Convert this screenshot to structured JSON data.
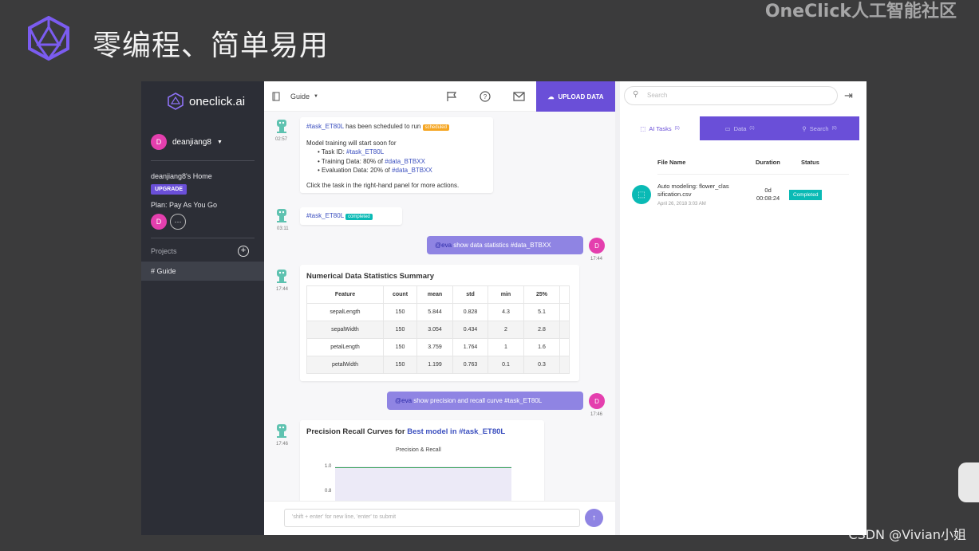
{
  "slide": {
    "title": "零编程、简单易用",
    "watermark_top": "OneClick人工智能社区",
    "watermark_bottom": "CSDN @Vivian小姐"
  },
  "sidebar": {
    "brand": "oneclick.ai",
    "username": "deanjiang8",
    "avatar_letter": "D",
    "home_label": "deanjiang8's Home",
    "upgrade": "UPGRADE",
    "plan": "Plan: Pay As You Go",
    "more": "···",
    "projects_label": "Projects",
    "add_label": "+",
    "project_item": "# Guide"
  },
  "toolbar": {
    "project_name": "Guide",
    "upload_label": "UPLOAD DATA"
  },
  "chat": {
    "msg1": {
      "time": "02:57",
      "tag": "#task_ET80L",
      "text": " has been scheduled to run ",
      "badge": "scheduled",
      "line1": "Model training will start soon for",
      "b1_label": "Task ID: ",
      "b1_tag": "#task_ET80L",
      "b2_label": "Training Data: 80% of ",
      "b2_tag": "#data_BTBXX",
      "b3_label": "Evaluation Data: 20% of ",
      "b3_tag": "#data_BTBXX",
      "footer": "Click the task in the right-hand panel for more actions."
    },
    "msg2": {
      "time": "03:11",
      "tag": "#task_ET80L",
      "badge": "completed"
    },
    "user1": {
      "time": "17:44",
      "mention": "@eva",
      "text": " show data statistics #data_BTBXX",
      "avatar": "D"
    },
    "msg3": {
      "time": "17:44",
      "title": "Numerical Data Statistics Summary",
      "headers": [
        "Feature",
        "count",
        "mean",
        "std",
        "min",
        "25%"
      ],
      "rows": [
        [
          "sepalLength",
          "150",
          "5.844",
          "0.828",
          "4.3",
          "5.1"
        ],
        [
          "sepalWidth",
          "150",
          "3.054",
          "0.434",
          "2",
          "2.8"
        ],
        [
          "petalLength",
          "150",
          "3.759",
          "1.764",
          "1",
          "1.6"
        ],
        [
          "petalWidth",
          "150",
          "1.199",
          "0.763",
          "0.1",
          "0.3"
        ]
      ]
    },
    "user2": {
      "time": "17:46",
      "mention": "@eva",
      "text": " show precision and recall curve #task_ET80L",
      "avatar": "D"
    },
    "msg4": {
      "time": "17:46",
      "title_a": "Precision Recall Curves for ",
      "title_b": "Best model in",
      "title_c": " #task_ET80L",
      "chart_title": "Precision & Recall",
      "y1": "1.0",
      "y2": "0.8"
    }
  },
  "input": {
    "placeholder": "'shift + enter' for new line, 'enter' to submit"
  },
  "right_panel": {
    "search_placeholder": "Search",
    "tabs": [
      {
        "label": "AI Tasks",
        "count": "(1)"
      },
      {
        "label": "Data",
        "count": "(1)"
      },
      {
        "label": "Search",
        "count": "(0)"
      }
    ],
    "columns": [
      "File Name",
      "Duration",
      "Status"
    ],
    "task": {
      "name_line1": "Auto modeling: flower_clas",
      "name_line2": "sification.csv",
      "date": "April 26, 2018 3:03 AM",
      "duration_line1": "0d",
      "duration_line2": "00:08:24",
      "status": "Completed"
    }
  },
  "colors": {
    "accent": "#6a4fd8",
    "avatar": "#e43fae",
    "teal": "#0abab5",
    "scheduled": "#f5a623"
  }
}
